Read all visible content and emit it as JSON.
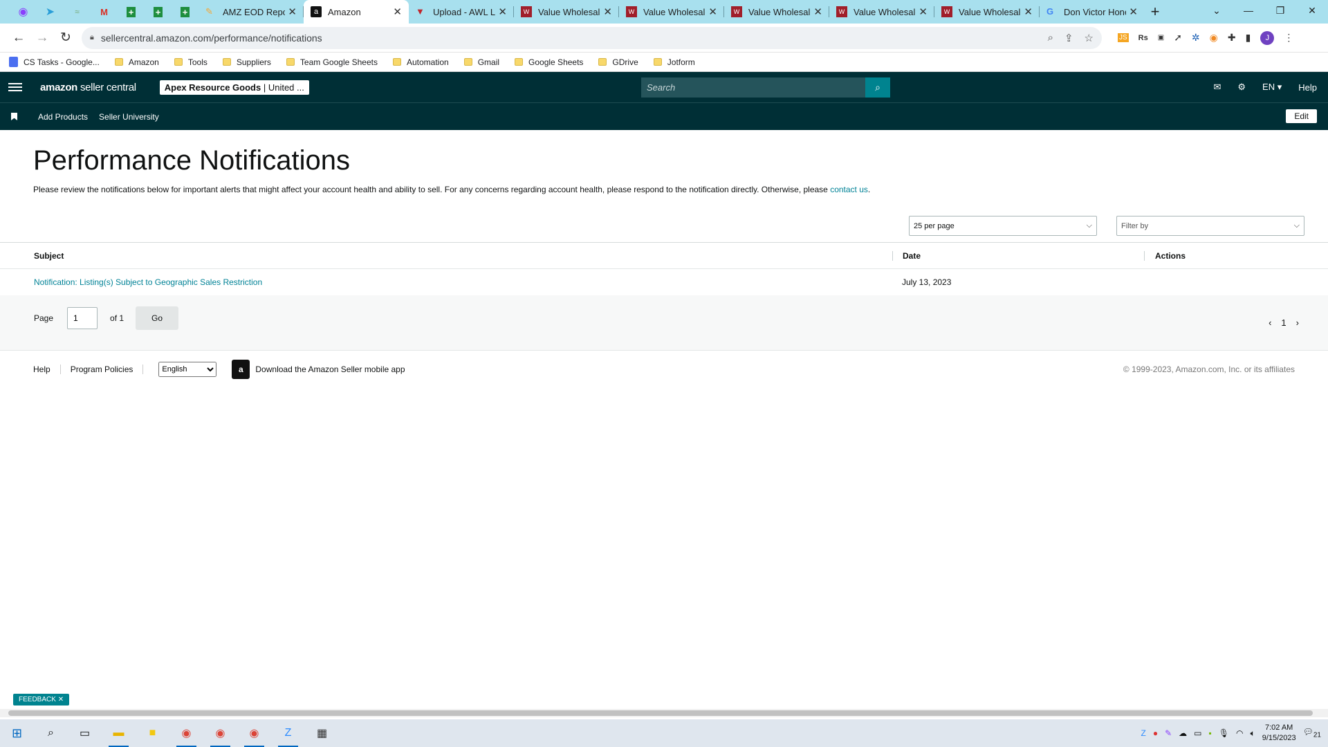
{
  "browser": {
    "tabs": [
      {
        "title": "AMZ EOD Repor",
        "icon": "amz-eod-icon",
        "active": false
      },
      {
        "title": "Amazon",
        "icon": "amazon-icon",
        "active": true
      },
      {
        "title": "Upload - AWL L/",
        "icon": "upload-icon",
        "active": false
      },
      {
        "title": "Value Wholesale",
        "icon": "vw-icon",
        "active": false
      },
      {
        "title": "Value Wholesale",
        "icon": "vw-icon",
        "active": false
      },
      {
        "title": "Value Wholesale",
        "icon": "vw-icon",
        "active": false
      },
      {
        "title": "Value Wholesale",
        "icon": "vw-icon",
        "active": false
      },
      {
        "title": "Value Wholesale",
        "icon": "vw-icon",
        "active": false
      },
      {
        "title": "Don Victor Hone",
        "icon": "google-icon",
        "active": false
      }
    ],
    "url": "sellercentral.amazon.com/performance/notifications",
    "bookmarks": [
      "CS Tasks - Google...",
      "Amazon",
      "Tools",
      "Suppliers",
      "Team Google Sheets",
      "Automation",
      "Gmail",
      "Google Sheets",
      "GDrive",
      "Jotform"
    ]
  },
  "header": {
    "logo_main": "amazon",
    "logo_sub": "seller central",
    "account_name": "Apex Resource Goods",
    "account_region": " | United ...",
    "search_placeholder": "Search",
    "language": "EN",
    "help": "Help"
  },
  "subnav": {
    "items": [
      "Add Products",
      "Seller University"
    ],
    "edit": "Edit"
  },
  "main": {
    "title": "Performance Notifications",
    "description": "Please review the notifications below for important alerts that might affect your account health and ability to sell. For any concerns regarding account health, please respond to the notification directly. Otherwise, please ",
    "contact_link": "contact us",
    "per_page": "25 per page",
    "filter_placeholder": "Filter by",
    "table": {
      "columns": [
        "Subject",
        "Date",
        "Actions"
      ],
      "rows": [
        {
          "subject": "Notification: Listing(s) Subject to Geographic Sales Restriction",
          "date": "July 13, 2023",
          "actions": ""
        }
      ]
    },
    "pagination": {
      "page_label": "Page",
      "page_value": "1",
      "of_label": "of 1",
      "go": "Go",
      "current": "1"
    }
  },
  "footer": {
    "help": "Help",
    "program_policies": "Program Policies",
    "language": "English",
    "app_text": "Download the Amazon Seller mobile app",
    "copyright": "© 1999-2023, Amazon.com, Inc. or its affiliates"
  },
  "feedback": "FEEDBACK",
  "taskbar": {
    "time": "7:02 AM",
    "date": "9/15/2023",
    "notifications": "21"
  },
  "colors": {
    "header_bg": "#002f36",
    "accent": "#008296",
    "tabbar": "#a8e0ee"
  }
}
